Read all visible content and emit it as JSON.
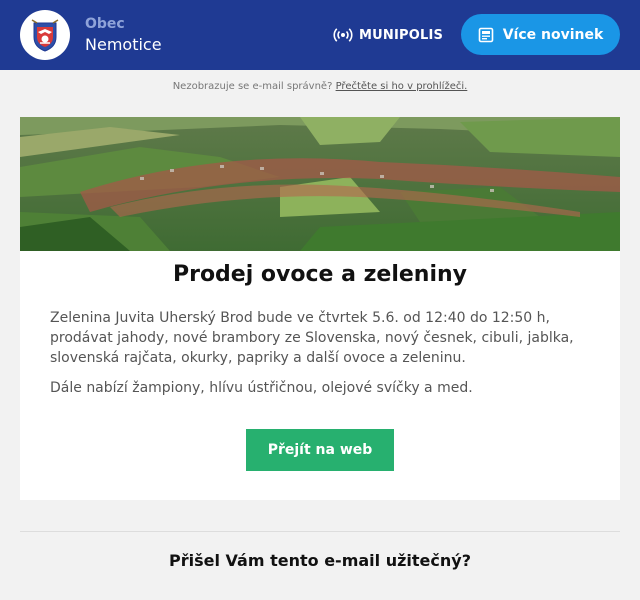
{
  "header": {
    "org_kind": "Obec",
    "org_name": "Nemotice",
    "crest_icon": "municipal-coat-of-arms-icon",
    "brand_icon": "broadcast-signal-icon",
    "brand_name": "MUNIPOLIS",
    "more_news_icon": "newspaper-icon",
    "more_news_label": "Více novinek",
    "colors": {
      "bar": "#1f3a93",
      "button": "#1a96e6"
    }
  },
  "preheader": {
    "text": "Nezobrazuje se e-mail správně?",
    "link": "Přečtěte si ho v prohlížeči."
  },
  "article": {
    "image_icon": "aerial-village-photo",
    "title": "Prodej ovoce a zeleniny",
    "paragraphs": [
      "Zelenina Juvita Uherský Brod bude ve čtvrtek 5.6. od 12:40 do 12:50 h, prodávat jahody, nové brambory ze Slovenska, nový česnek, cibuli, jablka, slovenská rajčata, okurky, papriky a další ovoce a zeleninu.",
      "Dále nabízí žampiony, hlívu ústřičnou, olejové svíčky a med."
    ],
    "cta_label": "Přejít na web",
    "colors": {
      "cta": "#27b06f"
    }
  },
  "feedback": {
    "question": "Přišel Vám tento e-mail užitečný?"
  }
}
